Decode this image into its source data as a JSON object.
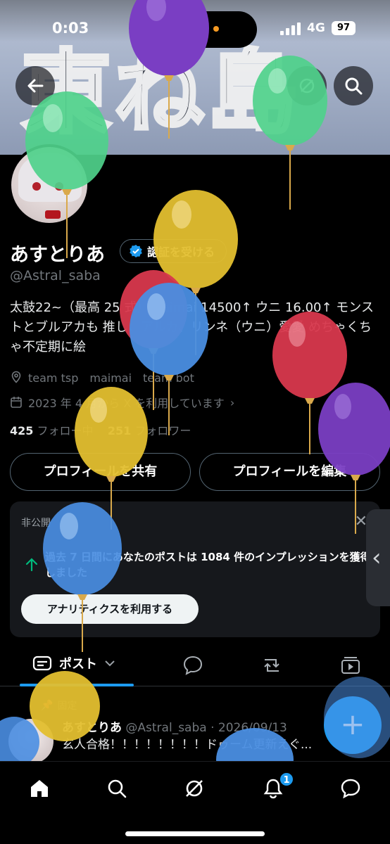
{
  "status_bar": {
    "time": "0:03",
    "network": "4G",
    "battery": "97"
  },
  "banner": {
    "text": "東ね島"
  },
  "profile": {
    "name": "あすとりあ",
    "verify_label": "認証を受ける",
    "handle": "@Astral_saba",
    "bio": "太鼓22~（最高 25 式）maimai 14500↑ ウニ 16.00↑ モンストとブルアカも 推し：アルカ、リンネ（ウニ）愛愛 めちゃくちゃ不定期に絵",
    "location": "team tsp　maimai　team bot",
    "joined": "2023 年 4 月から X を利用しています",
    "following_count": "425",
    "following_label": "フォロー中",
    "followers_count": "251",
    "followers_label": "フォロワー",
    "share_button": "プロフィールを共有",
    "edit_button": "プロフィールを編集"
  },
  "analytics_card": {
    "label": "非公開",
    "text": "過去 7 日間にあなたのポストは 1084 件のインプレッションを獲得しました",
    "button": "アナリティクスを利用する"
  },
  "tabs": {
    "active_label": "ポスト"
  },
  "post": {
    "pinned_label": "固定",
    "author": "あすとりあ",
    "meta": "@Astral_saba · 2026/09/13",
    "text": "玄人合格！！！！！！！！ドゥーム更新えぐ..."
  },
  "bottom_nav": {
    "notification_badge": "1"
  },
  "colors": {
    "accent": "#1d9bf0",
    "background": "#000000",
    "muted": "#71767b"
  },
  "icons": [
    "back-arrow-icon",
    "block-icon",
    "search-icon",
    "verified-badge-icon",
    "location-icon",
    "calendar-icon",
    "chevron-right-icon",
    "close-icon",
    "arrow-up-icon",
    "post-tab-icon",
    "chevron-down-icon",
    "reply-icon",
    "repost-icon",
    "media-icon",
    "pin-icon",
    "plus-icon",
    "home-icon",
    "grok-icon",
    "bell-icon",
    "message-icon"
  ]
}
